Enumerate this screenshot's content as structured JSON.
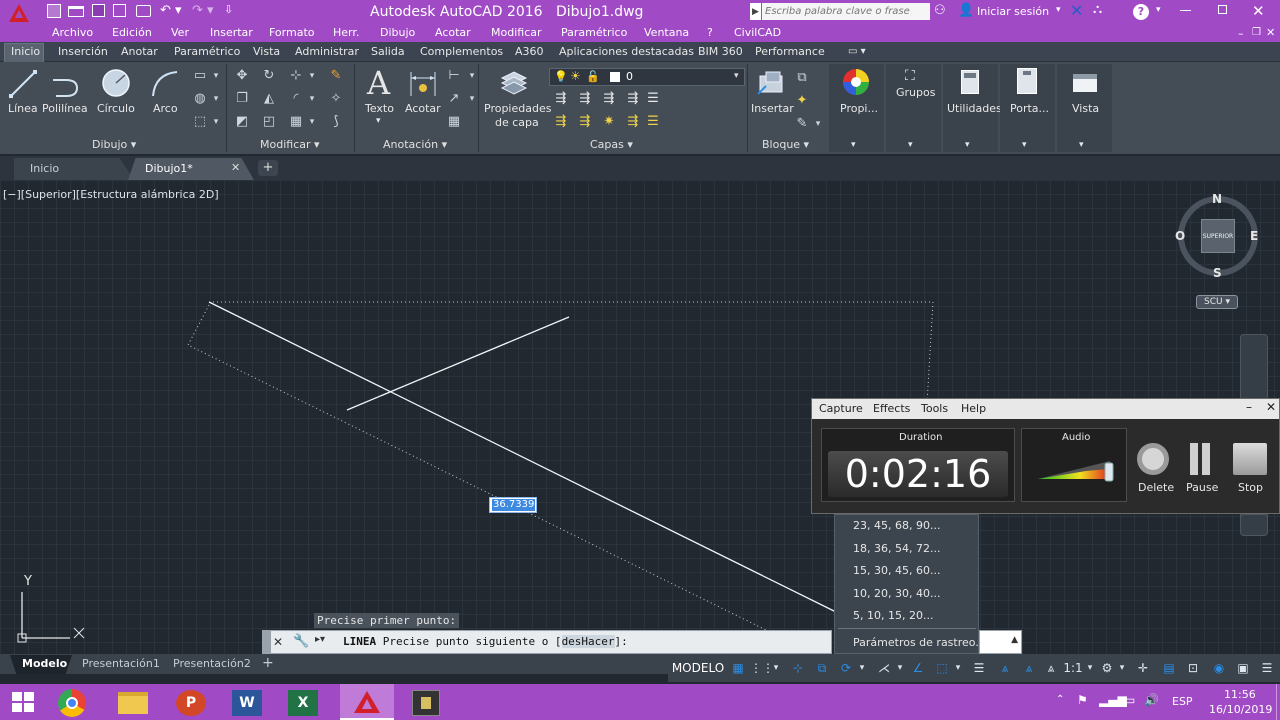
{
  "titlebar": {
    "app_title": "Autodesk AutoCAD 2016",
    "doc_title": "Dibujo1.dwg",
    "search_placeholder": "Escriba palabra clave o frase",
    "signin": "Iniciar sesión",
    "help": "?"
  },
  "menu": [
    "Archivo",
    "Edición",
    "Ver",
    "Insertar",
    "Formato",
    "Herr.",
    "Dibujo",
    "Acotar",
    "Modificar",
    "Paramétrico",
    "Ventana",
    "?",
    "CivilCAD"
  ],
  "ribbon_tabs": [
    "Inicio",
    "Inserción",
    "Anotar",
    "Paramétrico",
    "Vista",
    "Administrar",
    "Salida",
    "Complementos",
    "A360",
    "Aplicaciones destacadas",
    "BIM 360",
    "Performance"
  ],
  "ribbon": {
    "draw": {
      "linea": "Línea",
      "polilinea": "Polilínea",
      "circulo": "Círculo",
      "arco": "Arco",
      "panel": "Dibujo"
    },
    "modify": {
      "panel": "Modificar"
    },
    "annotation": {
      "texto": "Texto",
      "acotar": "Acotar",
      "panel": "Anotación"
    },
    "layers": {
      "props_1": "Propiedades",
      "props_2": "de capa",
      "current_layer": "0",
      "panel": "Capas"
    },
    "block": {
      "insertar": "Insertar",
      "panel": "Bloque"
    },
    "props": "Propi...",
    "grupos": "Grupos",
    "utilidades": "Utilidades",
    "porta": "Porta...",
    "vista": "Vista"
  },
  "doc_tabs": {
    "inicio": "Inicio",
    "dibujo": "Dibujo1*"
  },
  "viewport": {
    "label": "[−][Superior][Estructura alámbrica 2D]",
    "dyn_input": "36.7339",
    "viewcube": {
      "n": "N",
      "s": "S",
      "e": "E",
      "w": "O",
      "face": "SUPERIOR",
      "ucs": "SCU"
    },
    "ucs_y": "Y",
    "prompt_tooltip": "Precise primer punto:"
  },
  "command_line": {
    "cmd": "LINEA",
    "text": "Precise punto siguiente o [",
    "option": "desHacer",
    "tail": "]:"
  },
  "polar_menu": {
    "items": [
      "23, 45, 68, 90...",
      "18, 36, 54, 72...",
      "15, 30, 45, 60...",
      "10, 20, 30, 40...",
      "5, 10, 15, 20..."
    ],
    "settings": "Parámetros de rastreo..."
  },
  "recorder": {
    "menu": [
      "Capture",
      "Effects",
      "Tools",
      "Help"
    ],
    "duration_label": "Duration",
    "duration": "0:02:16",
    "audio_label": "Audio",
    "delete": "Delete",
    "pause": "Pause",
    "stop": "Stop"
  },
  "layout_tabs": [
    "Modelo",
    "Presentación1",
    "Presentación2"
  ],
  "status": {
    "modelo": "MODELO",
    "scale": "1:1"
  },
  "taskbar": {
    "lang": "ESP",
    "time": "11:56",
    "date": "16/10/2019"
  },
  "colors": {
    "title_bar": "#a14ac6",
    "accent_blue": "#2a8ee8",
    "viewport_bg": "#212830"
  }
}
